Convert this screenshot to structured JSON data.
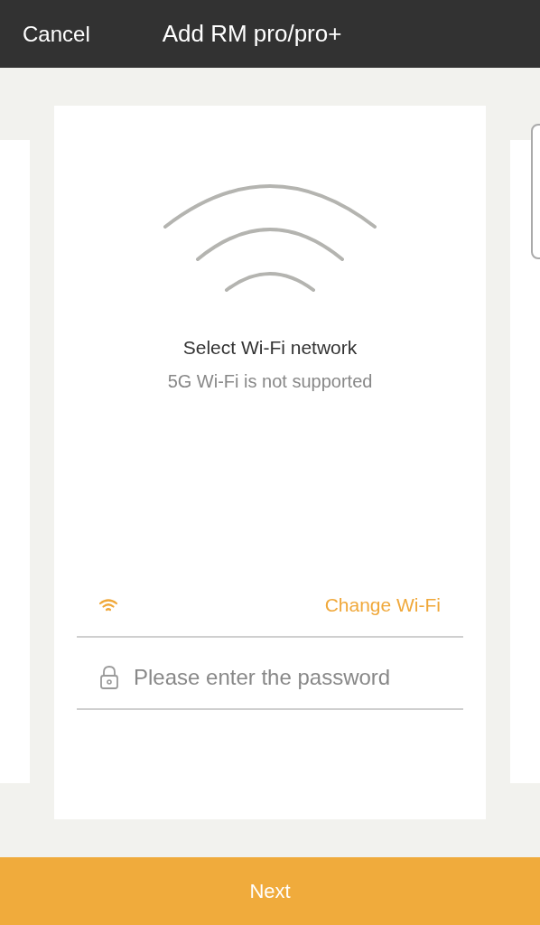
{
  "header": {
    "cancel": "Cancel",
    "title": "Add RM pro/pro+"
  },
  "card": {
    "title": "Select Wi-Fi network",
    "subtitle": "5G Wi-Fi is not supported",
    "change_wifi": "Change Wi-Fi",
    "password": {
      "placeholder": "Please enter the password"
    }
  },
  "footer": {
    "button": "Next"
  }
}
